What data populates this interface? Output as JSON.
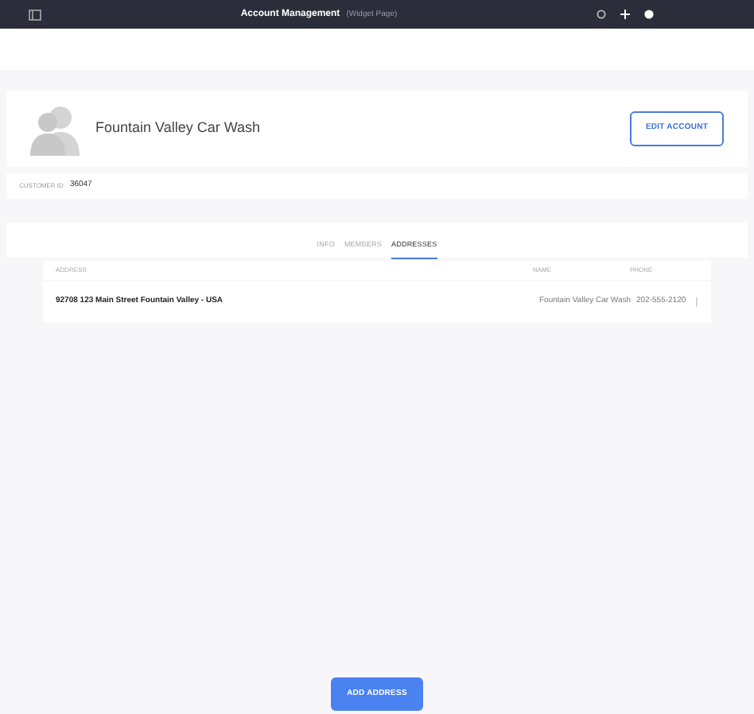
{
  "header": {
    "title": "Account Management",
    "subtitle": "(Widget Page)"
  },
  "account": {
    "name": "Fountain Valley Car Wash",
    "edit_button": "EDIT ACCOUNT",
    "customer_id_label": "CUSTOMER ID",
    "customer_id": "36047"
  },
  "tabs": [
    {
      "label": "INFO",
      "selected": false
    },
    {
      "label": "MEMBERS",
      "selected": false
    },
    {
      "label": "ADDRESSES",
      "selected": true
    }
  ],
  "table": {
    "columns": [
      "ADDRESS",
      "NAME",
      "PHONE"
    ],
    "rows": [
      {
        "address": "92708 123 Main Street Fountain Valley - USA",
        "name": "Fountain Valley Car Wash",
        "phone": "202-555-2120"
      }
    ]
  },
  "add_button": "ADD ADDRESS"
}
